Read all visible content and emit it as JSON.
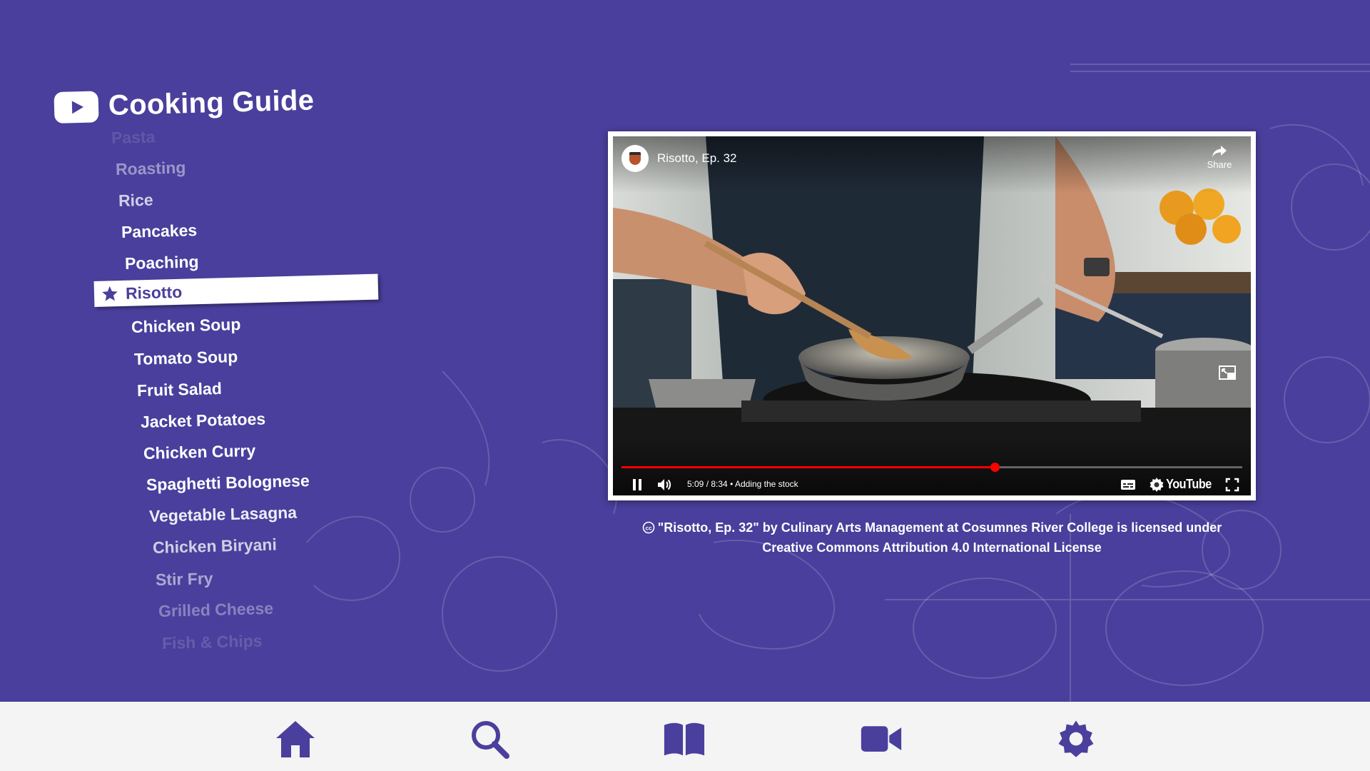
{
  "header": {
    "title": "Cooking Guide"
  },
  "recipes": {
    "items": [
      {
        "label": "Pasta"
      },
      {
        "label": "Roasting"
      },
      {
        "label": "Rice"
      },
      {
        "label": "Pancakes"
      },
      {
        "label": "Poaching"
      },
      {
        "label": "Risotto",
        "selected": true
      },
      {
        "label": "Chicken Soup"
      },
      {
        "label": "Tomato Soup"
      },
      {
        "label": "Fruit Salad"
      },
      {
        "label": "Jacket Potatoes"
      },
      {
        "label": "Chicken Curry"
      },
      {
        "label": "Spaghetti Bolognese"
      },
      {
        "label": "Vegetable Lasagna"
      },
      {
        "label": "Chicken Biryani"
      },
      {
        "label": "Stir Fry"
      },
      {
        "label": "Grilled Cheese"
      },
      {
        "label": "Fish & Chips"
      }
    ]
  },
  "video": {
    "title": "Risotto, Ep. 32",
    "share_label": "Share",
    "time": "5:09 / 8:34",
    "chapter": "Adding the stock",
    "progress": 0.601,
    "brand": "YouTube",
    "state": "playing"
  },
  "license": {
    "line1": "\"Risotto, Ep. 32\" by Culinary Arts Management at Cosumnes River College is licensed under",
    "line2": "Creative Commons Attribution 4.0 International License"
  },
  "nav": {
    "items": [
      {
        "name": "home",
        "icon": "home-icon"
      },
      {
        "name": "search",
        "icon": "search-icon"
      },
      {
        "name": "guide",
        "icon": "book-icon"
      },
      {
        "name": "videos",
        "icon": "video-camera-icon"
      },
      {
        "name": "settings",
        "icon": "gear-icon"
      }
    ]
  },
  "colors": {
    "background": "#4a3f9c",
    "accent": "#4a3f9c",
    "nav_bg": "#f4f4f4",
    "progress": "#ff0000"
  }
}
